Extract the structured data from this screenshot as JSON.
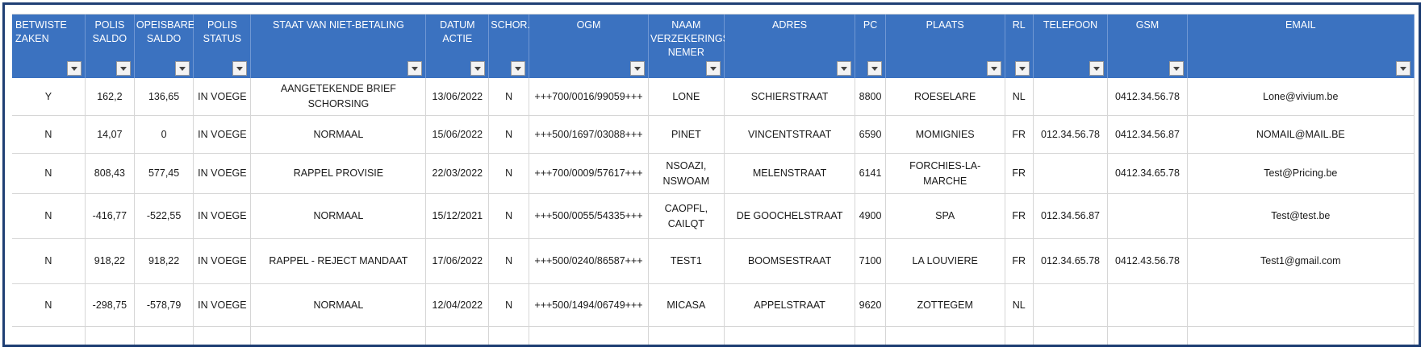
{
  "columns": [
    {
      "key": "betwiste",
      "label": "BETWISTE\nZAKEN"
    },
    {
      "key": "polis_saldo",
      "label": "POLIS\nSALDO"
    },
    {
      "key": "opeisbare_saldo",
      "label": "OPEISBARE\nSALDO"
    },
    {
      "key": "polis_status",
      "label": "POLIS\nSTATUS"
    },
    {
      "key": "staat",
      "label": "STAAT VAN NIET-BETALING"
    },
    {
      "key": "datum_actie",
      "label": "DATUM\nACTIE"
    },
    {
      "key": "schor",
      "label": "SCHOR."
    },
    {
      "key": "ogm",
      "label": "OGM"
    },
    {
      "key": "naam",
      "label": "NAAM\nVERZEKERINGS\nNEMER"
    },
    {
      "key": "adres",
      "label": "ADRES"
    },
    {
      "key": "pc",
      "label": "PC"
    },
    {
      "key": "plaats",
      "label": "PLAATS"
    },
    {
      "key": "rl",
      "label": "RL"
    },
    {
      "key": "telefoon",
      "label": "TELEFOON"
    },
    {
      "key": "gsm",
      "label": "GSM"
    },
    {
      "key": "email",
      "label": "EMAIL"
    }
  ],
  "rows": [
    [
      "Y",
      "162,2",
      "136,65",
      "IN VOEGE",
      "AANGETEKENDE BRIEF SCHORSING",
      "13/06/2022",
      "N",
      "+++700/0016/99059+++",
      "LONE",
      "SCHIERSTRAAT",
      "8800",
      "ROESELARE",
      "NL",
      "",
      "0412.34.56.78",
      "Lone@vivium.be"
    ],
    [
      "N",
      "14,07",
      "0",
      "IN VOEGE",
      "NORMAAL",
      "15/06/2022",
      "N",
      "+++500/1697/03088+++",
      "PINET",
      "VINCENTSTRAAT",
      "6590",
      "MOMIGNIES",
      "FR",
      "012.34.56.78",
      "0412.34.56.87",
      "NOMAIL@MAIL.BE"
    ],
    [
      "N",
      "808,43",
      "577,45",
      "IN VOEGE",
      "RAPPEL PROVISIE",
      "22/03/2022",
      "N",
      "+++700/0009/57617+++",
      "NSOAZI,\nNSWOAM",
      "MELENSTRAAT",
      "6141",
      "FORCHIES-LA-MARCHE",
      "FR",
      "",
      "0412.34.65.78",
      "Test@Pricing.be"
    ],
    [
      "N",
      "-416,77",
      "-522,55",
      "IN VOEGE",
      "NORMAAL",
      "15/12/2021",
      "N",
      "+++500/0055/54335+++",
      "CAOPFL,\nCAILQT",
      "DE GOOCHELSTRAAT",
      "4900",
      "SPA",
      "FR",
      "012.34.56.87",
      "",
      "Test@test.be"
    ],
    [
      "N",
      "918,22",
      "918,22",
      "IN VOEGE",
      "RAPPEL - REJECT MANDAAT",
      "17/06/2022",
      "N",
      "+++500/0240/86587+++",
      "TEST1",
      "BOOMSESTRAAT",
      "7100",
      "LA LOUVIERE",
      "FR",
      "012.34.65.78",
      "0412.43.56.78",
      "Test1@gmail.com"
    ],
    [
      "N",
      "-298,75",
      "-578,79",
      "IN VOEGE",
      "NORMAAL",
      "12/04/2022",
      "N",
      "+++500/1494/06749+++",
      "MICASA",
      "APPELSTRAAT",
      "9620",
      "ZOTTEGEM",
      "NL",
      "",
      "",
      ""
    ]
  ],
  "icons": {
    "filter": "filter-dropdown-icon"
  },
  "colors": {
    "header_bg": "#3b72c0",
    "frame_border": "#1f3f74",
    "gridline": "#d6d6d6"
  }
}
